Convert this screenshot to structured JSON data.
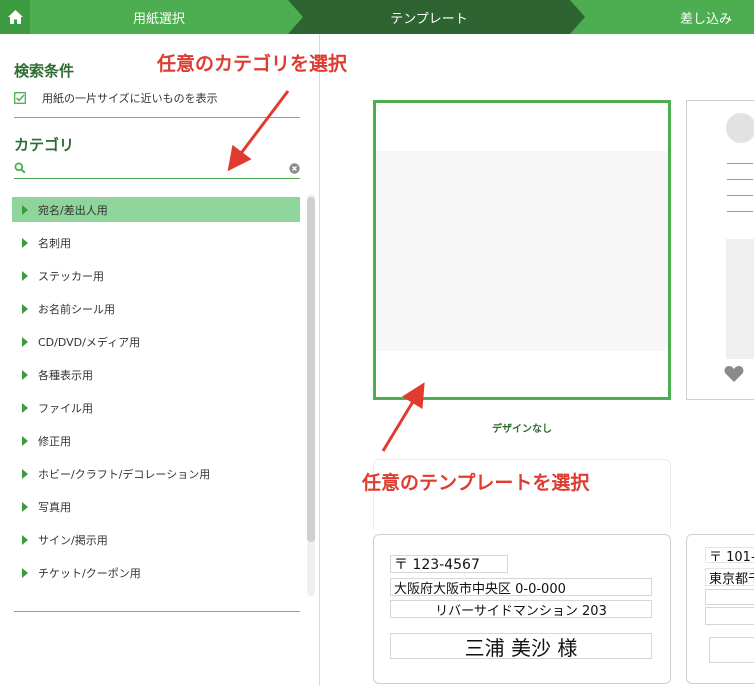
{
  "header": {
    "home_icon": "home-icon",
    "steps": [
      "用紙選択",
      "テンプレート",
      "差し込み"
    ],
    "colors": {
      "accent": "#4cae50",
      "active_step": "#2e6431"
    }
  },
  "sidebar": {
    "search_title": "検索条件",
    "checkbox_label": "用紙の一片サイズに近いものを表示",
    "category_title": "カテゴリ",
    "search_placeholder": "",
    "categories": [
      "宛名/差出人用",
      "名刺用",
      "ステッカー用",
      "お名前シール用",
      "CD/DVD/メディア用",
      "各種表示用",
      "ファイル用",
      "修正用",
      "ホビー/クラフト/デコレーション用",
      "写真用",
      "サイン/掲示用",
      "チケット/クーポン用"
    ],
    "active_category_index": 0
  },
  "main": {
    "blank_card_label": "デザインなし",
    "address_card": {
      "zip": "〒 123-4567",
      "address": "大阪府大阪市中央区 0-0-000",
      "building": "リバーサイドマンション 203",
      "name": "三浦 美沙 様"
    },
    "address_card_2": {
      "zip": "〒 101-",
      "address": "東京都千"
    }
  },
  "annotations": {
    "category": "任意のカテゴリを選択",
    "template": "任意のテンプレートを選択"
  }
}
